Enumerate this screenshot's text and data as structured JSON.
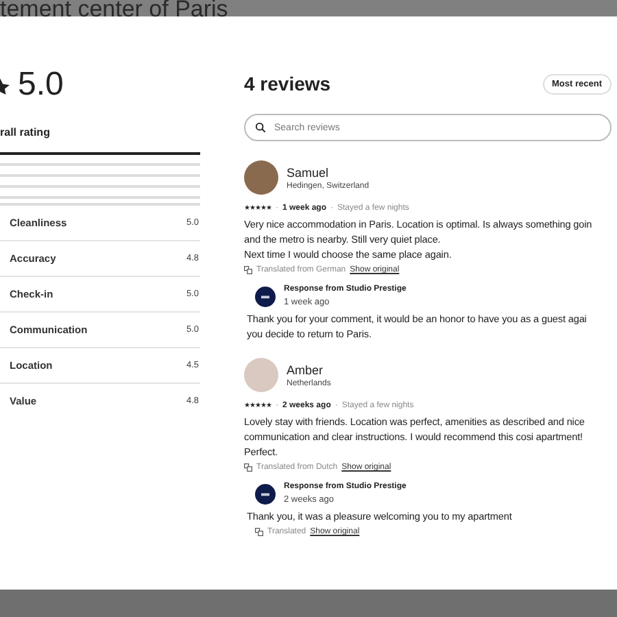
{
  "page_title": "tement center of Paris",
  "rating": {
    "score": "5.0",
    "label": "rall rating",
    "bars": [
      {
        "level": 1
      },
      {
        "level": 0
      },
      {
        "level": 0
      },
      {
        "level": 0
      },
      {
        "level": 0
      }
    ],
    "categories": [
      {
        "name": "Cleanliness",
        "value": "5.0"
      },
      {
        "name": "Accuracy",
        "value": "4.8"
      },
      {
        "name": "Check-in",
        "value": "5.0"
      },
      {
        "name": "Communication",
        "value": "5.0"
      },
      {
        "name": "Location",
        "value": "4.5"
      },
      {
        "name": "Value",
        "value": "4.8"
      }
    ]
  },
  "reviews_title": "4 reviews",
  "sort_button": "Most recent",
  "search": {
    "placeholder": "Search reviews"
  },
  "reviews": [
    {
      "name": "Samuel",
      "location": "Hedingen, Switzerland",
      "stars": 5,
      "separator": "·",
      "time": "1 week ago",
      "stay": "Stayed a few nights",
      "lines": [
        "Very nice accommodation in Paris. Location is optimal. Is always something goin",
        "and the metro is nearby. Still very quiet place.",
        "Next time I would choose the same place again."
      ],
      "translation": "Translated from German",
      "show_original": "Show original",
      "response": {
        "title": "Response from Studio Prestige",
        "time": "1 week ago",
        "lines": [
          "Thank you for your comment, it would be an honor to have you as a guest agai",
          "you decide to return to Paris."
        ]
      }
    },
    {
      "name": "Amber",
      "location": "Netherlands",
      "stars": 5,
      "separator": "·",
      "time": "2 weeks ago",
      "stay": "Stayed a few nights",
      "lines": [
        "Lovely stay with friends. Location was perfect, amenities as described and nice",
        "communication and clear instructions. I would recommend this cosi apartment!",
        "Perfect."
      ],
      "translation": "Translated from Dutch",
      "show_original": "Show original",
      "response": {
        "title": "Response from Studio Prestige",
        "time": "2 weeks ago",
        "lines": [
          "Thank you, it was a pleasure welcoming you to my apartment"
        ],
        "translation": "Translated",
        "show_original": "Show original"
      }
    }
  ]
}
